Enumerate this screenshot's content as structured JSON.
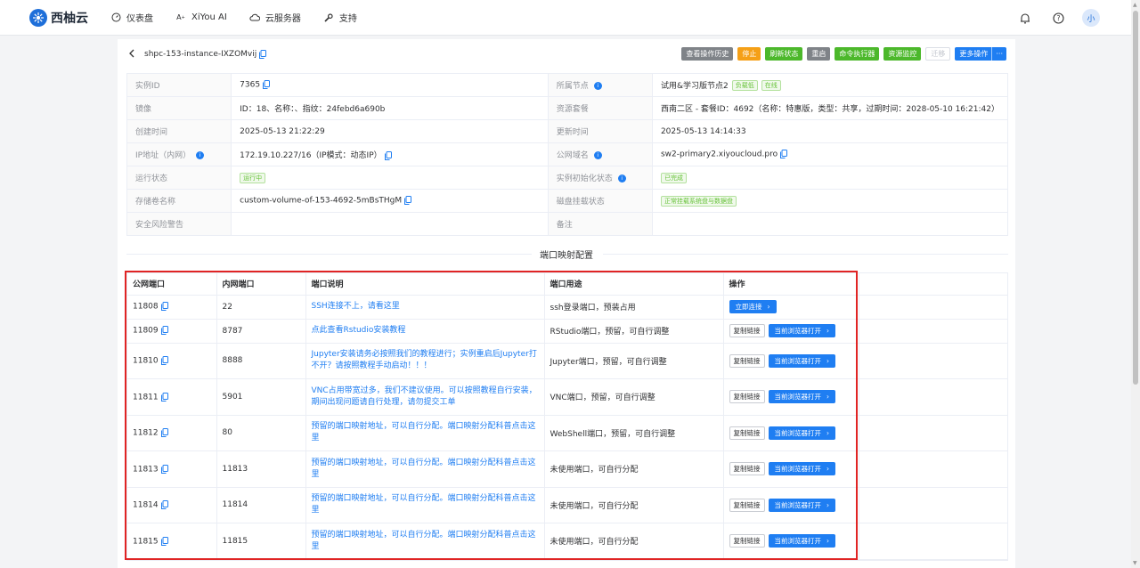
{
  "brand": {
    "name": "西柚云"
  },
  "nav": [
    {
      "label": "仪表盘",
      "icon": "dashboard-icon"
    },
    {
      "label": "XiYou AI",
      "icon": "ai-icon"
    },
    {
      "label": "云服务器",
      "icon": "cloud-icon"
    },
    {
      "label": "支持",
      "icon": "wrench-icon"
    }
  ],
  "user": {
    "avatar": "小"
  },
  "instance": {
    "name": "shpc-153-instance-IXZOMvij"
  },
  "actions": {
    "history": "查看操作历史",
    "stop": "停止",
    "refresh": "刷新状态",
    "restart": "重启",
    "command": "命令执行器",
    "monitor": "资源监控",
    "migrate": "迁移",
    "more": "更多操作",
    "more_dots": "···"
  },
  "info": {
    "id_label": "实例ID",
    "id_value": "7365",
    "node_label": "所属节点",
    "node_value": "试用&学习版节点2",
    "node_tag1": "负载低",
    "node_tag2": "在线",
    "image_label": "镜像",
    "image_value": "ID：18、名称：、指纹：24febd6a690b",
    "package_label": "资源套餐",
    "package_value": "西南二区 - 套餐ID：4692（名称：特惠版，类型：共享，过期时间：2028-05-10 16:21:42）",
    "created_label": "创建时间",
    "created_value": "2025-05-13 21:22:29",
    "updated_label": "更新时间",
    "updated_value": "2025-05-13 14:14:33",
    "ip_label": "IP地址（内网）",
    "ip_value": "172.19.10.227/16（IP模式：动态IP）",
    "domain_label": "公网域名",
    "domain_value": "sw2-primary2.xiyoucloud.pro",
    "run_label": "运行状态",
    "run_value": "运行中",
    "init_label": "实例初始化状态",
    "init_value": "已完成",
    "volume_label": "存储卷名称",
    "volume_value": "custom-volume-of-153-4692-5mBsTHgM",
    "disk_label": "磁盘挂载状态",
    "disk_value": "正常挂载系统盘与数据盘",
    "risk_label": "安全风险警告",
    "risk_value": "",
    "note_label": "备注",
    "note_value": ""
  },
  "port_section": {
    "title": "端口映射配置"
  },
  "port_table": {
    "headers": [
      "公网端口",
      "内网端口",
      "端口说明",
      "端口用途",
      "操作"
    ],
    "copy_label": "复制链接",
    "open_label": "当前浏览器打开",
    "connect_label": "立即连接",
    "rows": [
      {
        "public": "11808",
        "internal": "22",
        "desc": "SSH连接不上，请看这里",
        "usage": "ssh登录端口，预装占用"
      },
      {
        "public": "11809",
        "internal": "8787",
        "desc": "点此查看Rstudio安装教程",
        "usage": "RStudio端口，预留，可自行调整"
      },
      {
        "public": "11810",
        "internal": "8888",
        "desc": "Jupyter安装请务必按照我们的教程进行；实例重启后Jupyter打不开？请按照教程手动启动！！！",
        "usage": "Jupyter端口，预留，可自行调整"
      },
      {
        "public": "11811",
        "internal": "5901",
        "desc": "VNC占用带宽过多，我们不建议使用。可以按照教程自行安装，期间出现问题请自行处理，请勿提交工单",
        "usage": "VNC端口，预留，可自行调整"
      },
      {
        "public": "11812",
        "internal": "80",
        "desc": "预留的端口映射地址，可以自行分配。端口映射分配科普点击这里",
        "usage": "WebShell端口，预留，可自行调整"
      },
      {
        "public": "11813",
        "internal": "11813",
        "desc": "预留的端口映射地址，可以自行分配。端口映射分配科普点击这里",
        "usage": "未使用端口，可自行分配"
      },
      {
        "public": "11814",
        "internal": "11814",
        "desc": "预留的端口映射地址，可以自行分配。端口映射分配科普点击这里",
        "usage": "未使用端口，可自行分配"
      },
      {
        "public": "11815",
        "internal": "11815",
        "desc": "预留的端口映射地址，可以自行分配。端口映射分配科普点击这里",
        "usage": "未使用端口，可自行分配"
      }
    ]
  },
  "colors": {
    "primary": "#1f7ef2",
    "success": "#4cb82b",
    "warning": "#f5a017",
    "highlight": "#e02424"
  }
}
